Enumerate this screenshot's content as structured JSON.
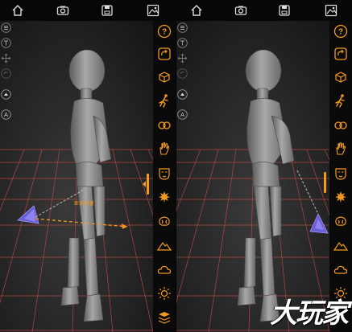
{
  "topbar": {
    "icons": [
      "home-icon",
      "camera-icon",
      "save-icon",
      "gallery-icon",
      "home-icon",
      "camera-icon",
      "save-icon",
      "gallery-icon"
    ]
  },
  "left_tools": {
    "icons": [
      "menu-icon",
      "text-icon",
      "move-icon",
      "undo-icon",
      "flip-icon",
      "axis-icon"
    ],
    "axis_label": "A"
  },
  "right_toolbar": {
    "help_label": "?",
    "icons": [
      "help-icon",
      "rotate-icon",
      "cube-icon",
      "pose-icon",
      "link-icon",
      "hand-icon",
      "face-icon",
      "light-icon",
      "spotlight-icon",
      "brain-icon",
      "mountain-icon",
      "cloud-icon",
      "sun-icon",
      "background-icon"
    ]
  },
  "viewport": {
    "distance_label": "距离测量"
  },
  "colors": {
    "accent": "#f39a1e",
    "grid": "#c94a4a",
    "figure": "#8f8f8f",
    "light_marker": "#6a5fd0"
  },
  "watermark": "大玩家"
}
